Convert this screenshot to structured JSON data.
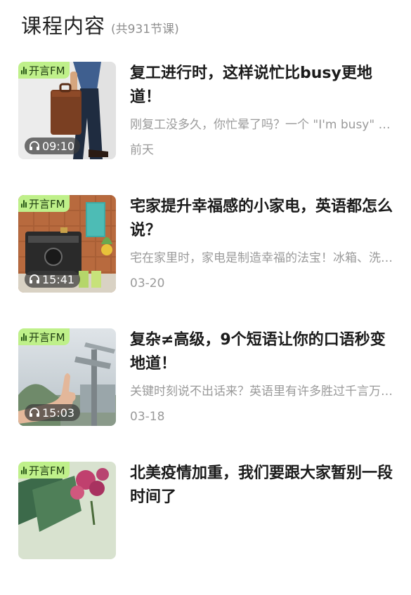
{
  "header": {
    "title": "课程内容",
    "count": "(共931节课)"
  },
  "episodes": [
    {
      "badge": "开言FM",
      "duration": "09:10",
      "title": "复工进行时，这样说忙比busy更地道！",
      "desc": "刚复工没多久，你忙晕了吗？一个 \"I'm busy\" 已经",
      "date": "前天"
    },
    {
      "badge": "开言FM",
      "duration": "15:41",
      "title": "宅家提升幸福感的小家电，英语都怎么说？",
      "desc": "宅在家里时，家电是制造幸福的法宝！冰箱、洗衣机",
      "date": "03-20"
    },
    {
      "badge": "开言FM",
      "duration": "15:03",
      "title": "复杂≠高级，9个短语让你的口语秒变地道！",
      "desc": "关键时刻说不出话来？英语里有许多胜过千言万语的",
      "date": "03-18"
    },
    {
      "badge": "开言FM",
      "duration": "",
      "title": "北美疫情加重，我们要跟大家暂别一段时间了",
      "desc": "",
      "date": ""
    }
  ],
  "colors": {
    "badge_bg": "#bff08a",
    "title": "#1b1b1b",
    "meta": "#9a9a9a"
  },
  "icons": {
    "badge": "sound-wave-icon",
    "duration": "headphone-icon"
  }
}
